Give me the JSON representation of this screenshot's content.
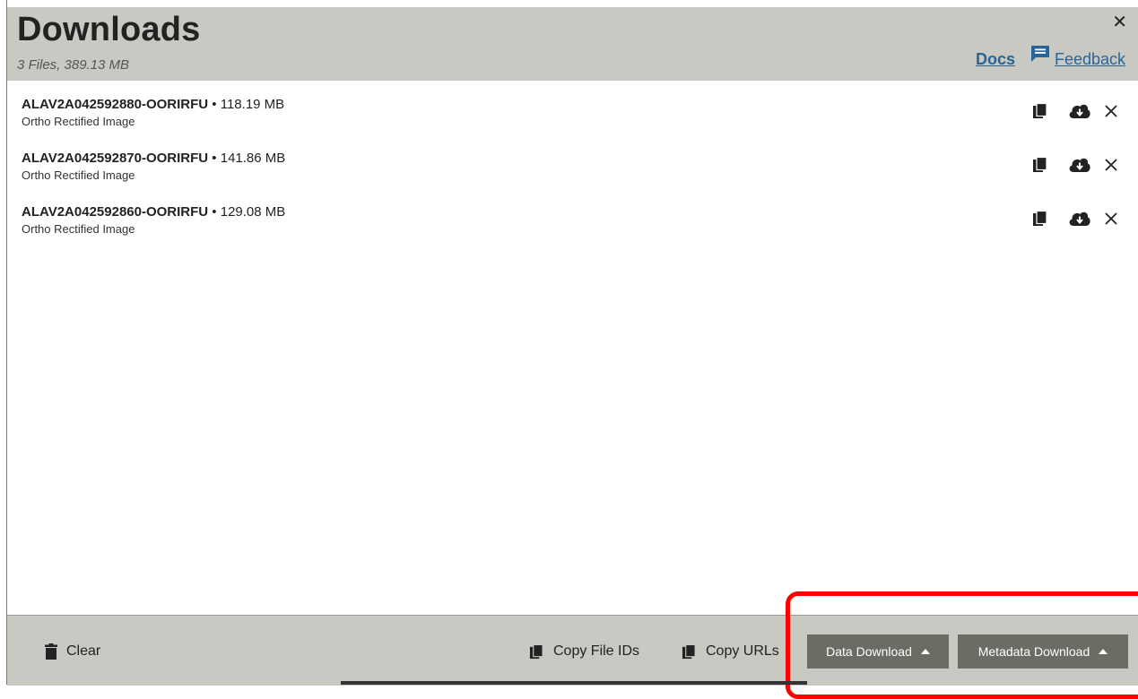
{
  "header": {
    "title": "Downloads",
    "subtitle": "3 Files, 389.13 MB",
    "docs_label": "Docs",
    "feedback_label": "Feedback",
    "close_label": "✕"
  },
  "files": [
    {
      "id": "ALAV2A042592880-OORIRFU",
      "size": "118.19 MB",
      "type": "Ortho Rectified Image"
    },
    {
      "id": "ALAV2A042592870-OORIRFU",
      "size": "141.86 MB",
      "type": "Ortho Rectified Image"
    },
    {
      "id": "ALAV2A042592860-OORIRFU",
      "size": "129.08 MB",
      "type": "Ortho Rectified Image"
    }
  ],
  "footer": {
    "clear_label": "Clear",
    "copy_ids_label": "Copy File IDs",
    "copy_urls_label": "Copy URLs",
    "data_download_label": "Data Download",
    "metadata_download_label": "Metadata Download"
  },
  "colors": {
    "header_bg": "#c8c9c3",
    "link": "#2a6496",
    "dark_button": "#6a6d64",
    "highlight": "#ff0000"
  }
}
